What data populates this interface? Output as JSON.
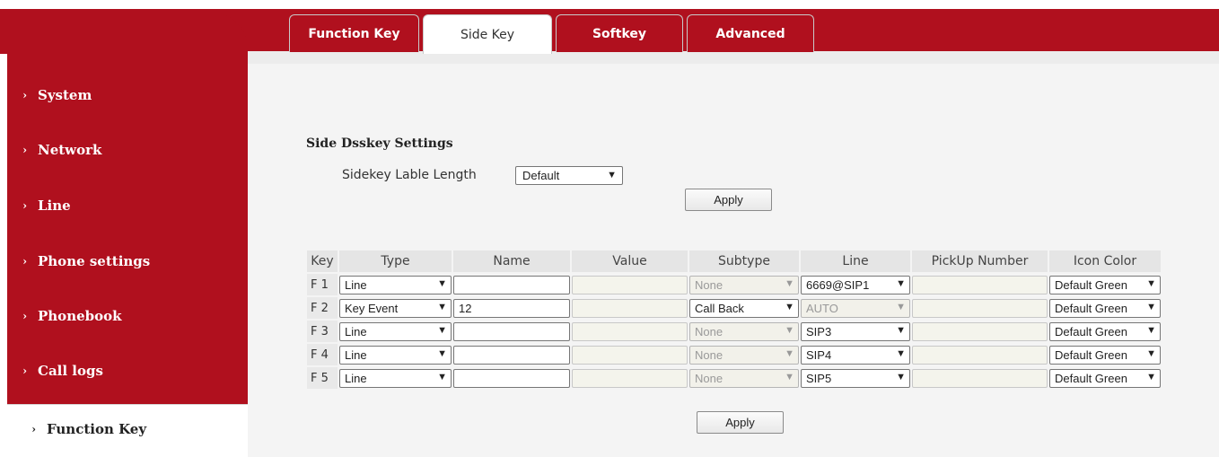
{
  "sidebar": {
    "items": [
      {
        "label": "System"
      },
      {
        "label": "Network"
      },
      {
        "label": "Line"
      },
      {
        "label": "Phone settings"
      },
      {
        "label": "Phonebook"
      },
      {
        "label": "Call logs"
      },
      {
        "label": "Function Key",
        "active": true
      }
    ],
    "chevron": "›"
  },
  "tabs": [
    {
      "label": "Function Key"
    },
    {
      "label": "Side Key",
      "active": true
    },
    {
      "label": "Softkey"
    },
    {
      "label": "Advanced"
    }
  ],
  "settings": {
    "title": "Side Dsskey Settings",
    "length_label": "Sidekey Lable Length",
    "length_value": "Default",
    "apply_label": "Apply"
  },
  "table": {
    "headers": [
      "Key",
      "Type",
      "Name",
      "Value",
      "Subtype",
      "Line",
      "PickUp Number",
      "Icon Color"
    ],
    "rows": [
      {
        "key": "F 1",
        "type": "Line",
        "name": "",
        "value": "",
        "subtype": "None",
        "line": "6669@SIP1",
        "pickup": "",
        "icon_color": "Default Green"
      },
      {
        "key": "F 2",
        "type": "Key Event",
        "name": "12",
        "value": "",
        "subtype": "Call Back",
        "line": "AUTO",
        "pickup": "",
        "icon_color": "Default Green"
      },
      {
        "key": "F 3",
        "type": "Line",
        "name": "",
        "value": "",
        "subtype": "None",
        "line": "SIP3",
        "pickup": "",
        "icon_color": "Default Green"
      },
      {
        "key": "F 4",
        "type": "Line",
        "name": "",
        "value": "",
        "subtype": "None",
        "line": "SIP4",
        "pickup": "",
        "icon_color": "Default Green"
      },
      {
        "key": "F 5",
        "type": "Line",
        "name": "",
        "value": "",
        "subtype": "None",
        "line": "SIP5",
        "pickup": "",
        "icon_color": "Default Green"
      }
    ],
    "apply_label": "Apply"
  },
  "colors": {
    "brand_red": "#b0101e"
  },
  "icons": {
    "chevron": "chevron-right-icon",
    "dropdown": "chevron-down-icon"
  }
}
